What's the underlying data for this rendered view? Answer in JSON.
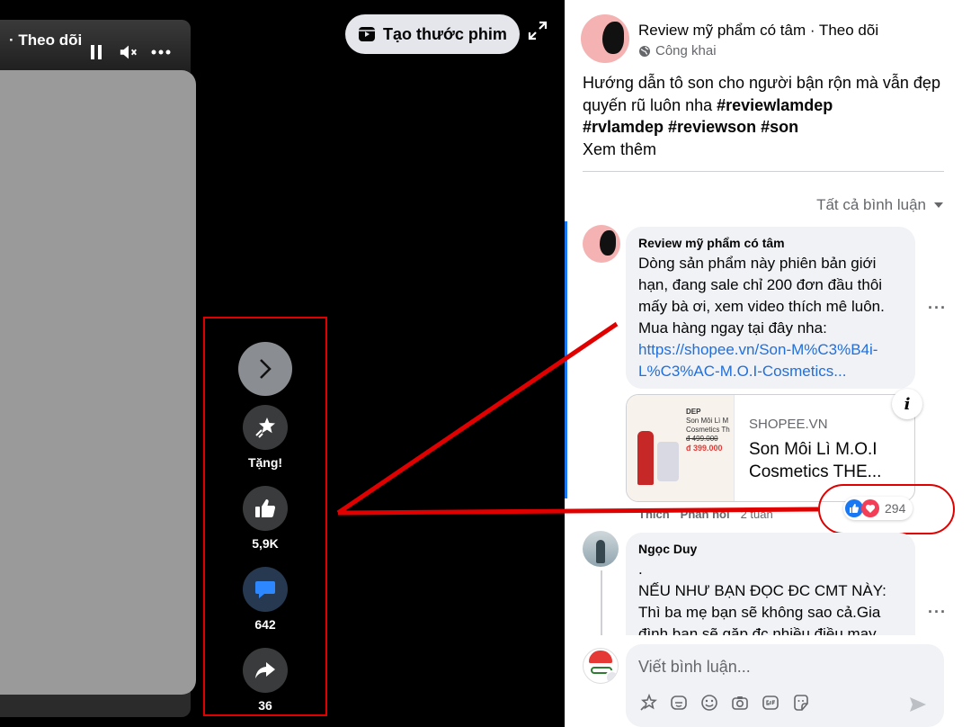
{
  "video": {
    "author_follow": "· Theo dõi",
    "create_reel_label": "Tạo thước phim",
    "actions": {
      "gift_label": "Tặng!",
      "like_count": "5,9K",
      "comment_count": "642",
      "share_count": "36"
    }
  },
  "post": {
    "page_name": "Review mỹ phẩm có tâm",
    "follow": "· Theo dõi",
    "privacy": "Công khai",
    "caption_text": "Hướng dẫn tô son cho người bận rộn mà vẫn đẹp quyến rũ luôn nha",
    "hashtag_1": "#reviewlamdep",
    "hashtags_line2": "#rvlamdep #reviewson #son",
    "see_more": "Xem thêm",
    "comment_filter": "Tất cả bình luận"
  },
  "comments": [
    {
      "author": "Review mỹ phẩm có tâm",
      "text": "Dòng sản phẩm này phiên bản giới hạn, đang sale chỉ 200 đơn đầu thôi mấy bà ơi, xem video thích mê luôn. Mua hàng ngay tại đây nha:",
      "link": "https://shopee.vn/Son-M%C3%B4i-L%C3%AC-M.O.I-Cosmetics...",
      "card": {
        "domain": "SHOPEE.VN",
        "title": "Son Môi Lì M.O.I Cosmetics THE...",
        "thumb_brand": "DEP",
        "thumb_text": "Son Môi Lì M Cosmetics Th",
        "thumb_old_price": "đ 499.000",
        "thumb_price": "đ 399.000"
      },
      "like_label": "Thích",
      "reply_label": "Phản hồi",
      "time": "2 tuần",
      "reaction_count": "294"
    },
    {
      "author": "Ngọc Duy",
      "text_line1": ".",
      "text": "NẾU NHƯ BẠN ĐỌC ĐC CMT NÀY: Thì ba mẹ bạn sẽ không sao cả.Gia đình bạn sẽ gặp đc nhiều điều may"
    }
  ],
  "composer": {
    "placeholder": "Viết bình luận..."
  },
  "colors": {
    "accent": "#1877f2",
    "highlight": "#e00000",
    "bubble": "#f0f2f5"
  }
}
